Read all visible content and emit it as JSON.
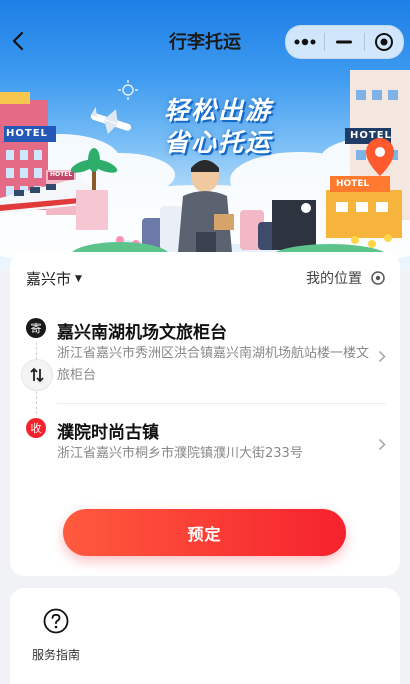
{
  "nav": {
    "title": "行李托运",
    "back_icon": "chevron-left-icon",
    "capsule": {
      "more_icon": "more-dots-icon",
      "minimize_icon": "minus-icon",
      "close_icon": "target-circle-icon"
    }
  },
  "banner": {
    "slogan_line1": "轻松出游",
    "slogan_line2": "省心托运",
    "sign_hotel_left": "HOTEL",
    "sign_hotel_right": "HOTEL",
    "sign_hotel_mid": "HOTEL",
    "sign_hotel_small": "HOTEL"
  },
  "location_card": {
    "city": "嘉兴市",
    "my_location": "我的位置",
    "origin": {
      "badge": "寄",
      "name": "嘉兴南湖机场文旅柜台",
      "address": "浙江省嘉兴市秀洲区洪合镇嘉兴南湖机场航站楼一楼文旅柜台"
    },
    "destination": {
      "badge": "收",
      "name": "濮院时尚古镇",
      "address": "浙江省嘉兴市桐乡市濮院镇濮川大街233号"
    },
    "book_button": "预定"
  },
  "services": [
    {
      "icon": "question-circle-icon",
      "label": "服务指南"
    }
  ],
  "colors": {
    "accent_red": "#f5222d",
    "sky_blue": "#2b8ae8"
  }
}
